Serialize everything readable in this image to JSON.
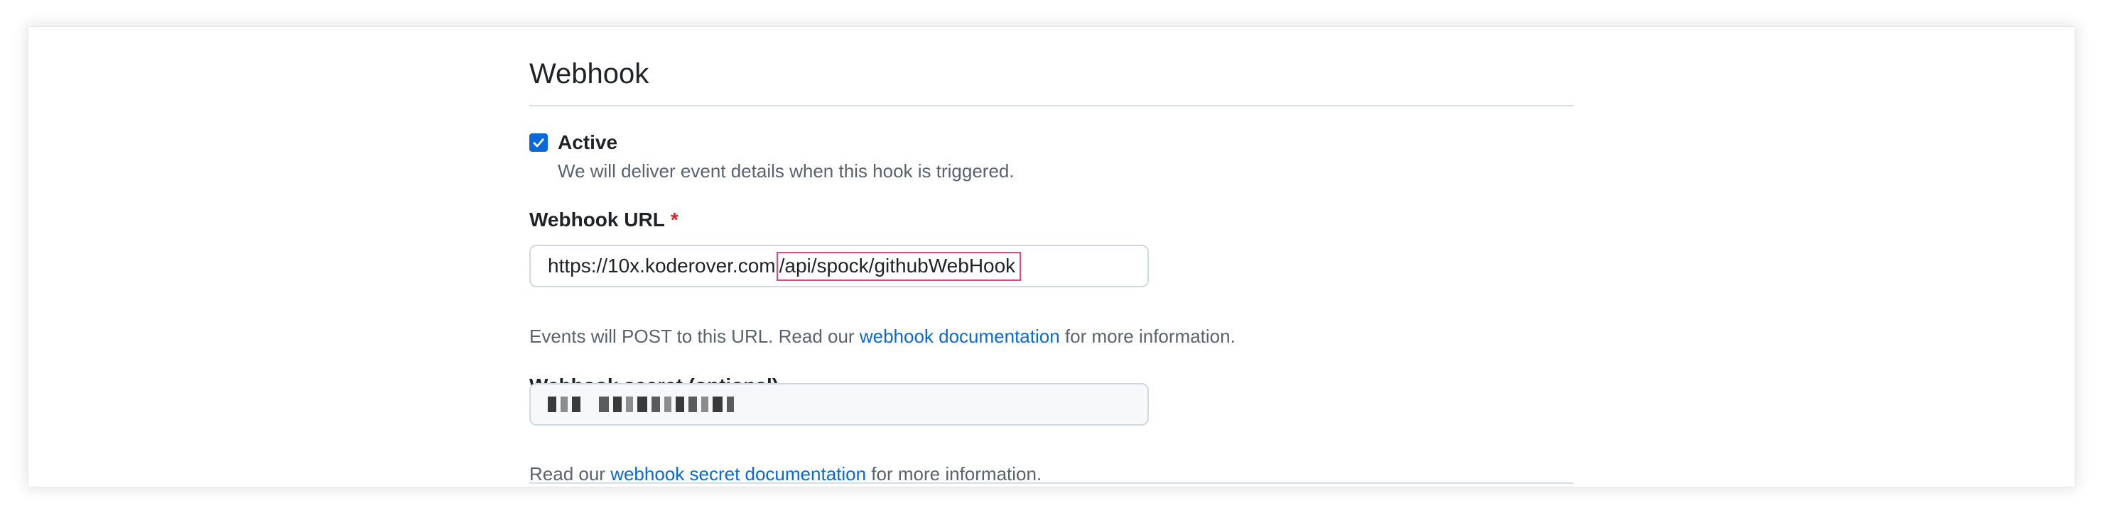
{
  "section": {
    "title": "Webhook"
  },
  "active": {
    "label": "Active",
    "checked": true,
    "description": "We will deliver event details when this hook is triggered."
  },
  "webhook_url": {
    "label": "Webhook URL",
    "required_marker": "*",
    "value_prefix": "https://10x.koderover.com",
    "value_highlight": "/api/spock/githubWebHook",
    "help_before": "Events will POST to this URL. Read our ",
    "help_link": "webhook documentation",
    "help_after": " for more information."
  },
  "webhook_secret": {
    "label": "Webhook secret (optional)",
    "help_before": "Read our ",
    "help_link": "webhook secret documentation",
    "help_after": " for more information."
  },
  "colors": {
    "link": "#0969da",
    "checkbox": "#0969da",
    "required": "#cf222e",
    "highlight_border": "#e8437a"
  }
}
